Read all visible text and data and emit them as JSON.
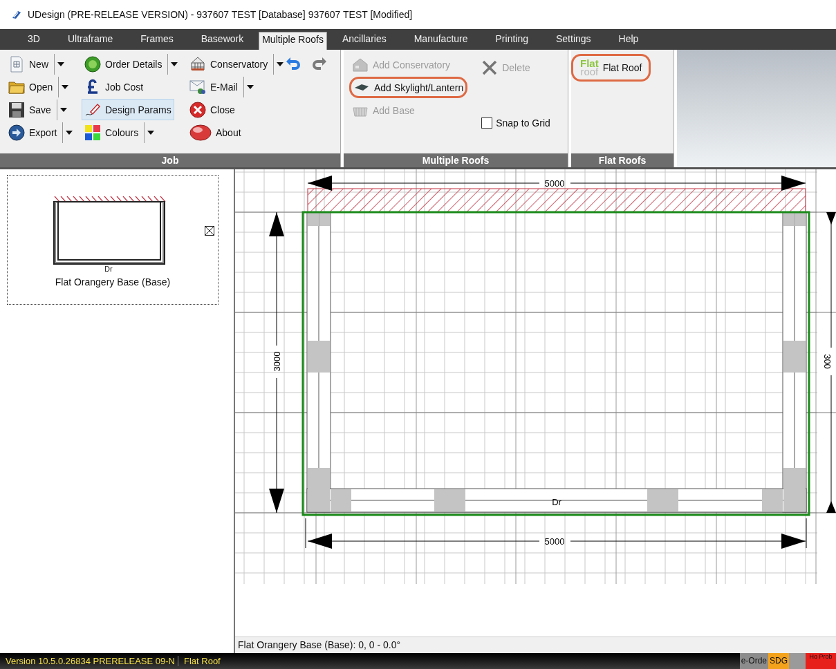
{
  "window": {
    "title": "UDesign (PRE-RELEASE VERSION) - 937607 TEST [Database] 937607 TEST [Modified]"
  },
  "tabs": [
    {
      "label": "3D",
      "selected": false
    },
    {
      "label": "Ultraframe",
      "selected": false
    },
    {
      "label": "Frames",
      "selected": false
    },
    {
      "label": "Basework",
      "selected": false
    },
    {
      "label": "Multiple Roofs",
      "selected": true
    },
    {
      "label": "Ancillaries",
      "selected": false
    },
    {
      "label": "Manufacture",
      "selected": false
    },
    {
      "label": "Printing",
      "selected": false
    },
    {
      "label": "Settings",
      "selected": false
    },
    {
      "label": "Help",
      "selected": false
    }
  ],
  "job_group": {
    "label": "Job",
    "items": [
      {
        "label": "New",
        "dropdown": true,
        "highlighted": false
      },
      {
        "label": "Order Details",
        "dropdown": true,
        "highlighted": false
      },
      {
        "label": "Conservatory",
        "dropdown": true,
        "highlighted": false
      },
      {
        "label": "Open",
        "dropdown": true,
        "highlighted": false
      },
      {
        "label": "Job Cost",
        "dropdown": false,
        "highlighted": false
      },
      {
        "label": "E-Mail",
        "dropdown": true,
        "highlighted": false
      },
      {
        "label": "Save",
        "dropdown": true,
        "highlighted": false
      },
      {
        "label": "Design Params",
        "dropdown": false,
        "highlighted": true
      },
      {
        "label": "Close",
        "dropdown": false,
        "highlighted": false
      },
      {
        "label": "Export",
        "dropdown": true,
        "highlighted": false
      },
      {
        "label": "Colours",
        "dropdown": true,
        "highlighted": false
      },
      {
        "label": "About",
        "dropdown": false,
        "highlighted": false
      }
    ]
  },
  "multiple_roofs_group": {
    "label": "Multiple Roofs",
    "columns": [
      [
        {
          "kind": "button",
          "label": "Add Conservatory",
          "disabled": true,
          "annotated": false
        },
        {
          "kind": "button",
          "label": "Add Skylight/Lantern",
          "disabled": false,
          "annotated": true
        },
        {
          "kind": "button",
          "label": "Add Base",
          "disabled": true,
          "annotated": false
        }
      ],
      [
        {
          "kind": "button",
          "label": "Delete",
          "disabled": true,
          "annotated": false
        },
        {
          "kind": "checkbox",
          "label": "Snap to Grid",
          "checked": false
        }
      ]
    ]
  },
  "flat_roofs_group": {
    "label": "Flat Roofs",
    "items": [
      {
        "label": "Flat Roof",
        "logo_top": "Flat",
        "logo_bottom": "roof",
        "annotated": true
      }
    ]
  },
  "thumbnail": {
    "caption": "Flat Orangery Base (Base)",
    "door_label": "Dr"
  },
  "canvas": {
    "top_dimension": "5000",
    "bottom_dimension": "5000",
    "left_dimension": "3000",
    "right_dimension": "300",
    "door_label": "Dr"
  },
  "position_readout": "Flat Orangery Base (Base): 0, 0 - 0.0°",
  "status_bar": {
    "version": "Version 10.5.0.26834 PRERELEASE 09-N",
    "mode": "Flat Roof",
    "indicators": [
      {
        "kind": "grey",
        "text": "e-Orde"
      },
      {
        "kind": "orange",
        "text": "SDG"
      },
      {
        "kind": "blank"
      },
      {
        "kind": "alert",
        "text": "Ho Prob"
      }
    ]
  }
}
